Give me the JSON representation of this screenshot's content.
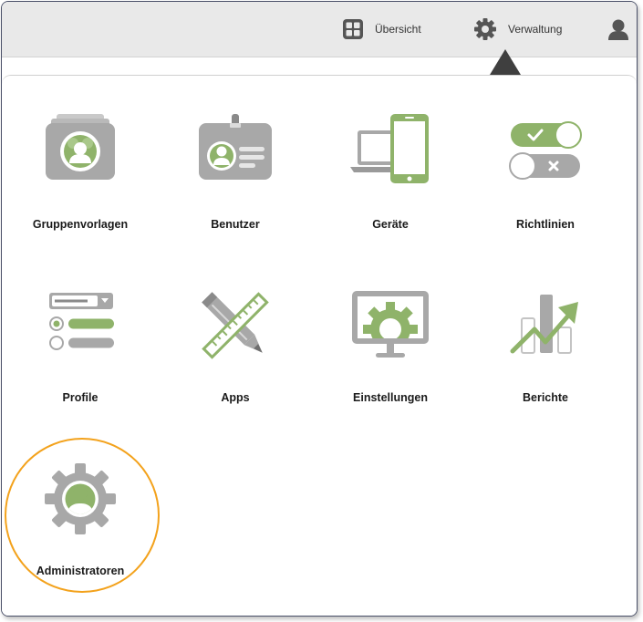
{
  "topbar": {
    "overview": {
      "label": "Übersicht",
      "icon": "grid-icon"
    },
    "admin": {
      "label": "Verwaltung",
      "icon": "gear-icon"
    },
    "user": {
      "icon": "user-icon"
    }
  },
  "tiles": [
    {
      "label": "Gruppenvorlagen",
      "icon": "group-template-icon"
    },
    {
      "label": "Benutzer",
      "icon": "badge-icon"
    },
    {
      "label": "Geräte",
      "icon": "devices-icon"
    },
    {
      "label": "Richtlinien",
      "icon": "toggles-icon"
    },
    {
      "label": "Profile",
      "icon": "profile-list-icon"
    },
    {
      "label": "Apps",
      "icon": "pencil-ruler-icon"
    },
    {
      "label": "Einstellungen",
      "icon": "monitor-gear-icon"
    },
    {
      "label": "Berichte",
      "icon": "chart-arrow-icon"
    },
    {
      "label": "Administratoren",
      "icon": "admin-gear-icon"
    }
  ],
  "colors": {
    "accent_green": "#8fb36a",
    "icon_gray": "#a8a8a8",
    "highlight": "#f3a21c"
  }
}
